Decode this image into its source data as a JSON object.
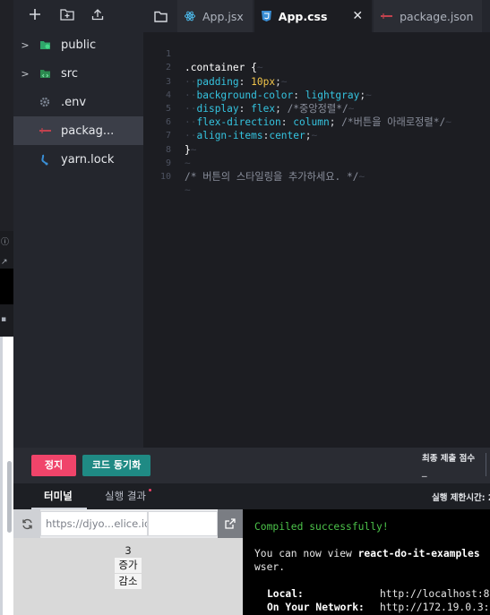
{
  "explorer": {
    "items": [
      {
        "name": "public",
        "type": "folder"
      },
      {
        "name": "src",
        "type": "folder"
      },
      {
        "name": ".env",
        "type": "file"
      },
      {
        "name": "packag...",
        "type": "file",
        "selected": true
      },
      {
        "name": "yarn.lock",
        "type": "file"
      }
    ]
  },
  "tabs": [
    {
      "label": "App.jsx",
      "icon": "react-icon"
    },
    {
      "label": "App.css",
      "icon": "css-icon",
      "active": true
    },
    {
      "label": "package.json",
      "icon": "json-icon"
    }
  ],
  "code": {
    "line_numbers": [
      "1",
      "2",
      "3",
      "4",
      "5",
      "6",
      "7",
      "8",
      "9",
      "10"
    ],
    "l1": ".container {",
    "l2_prop": "padding",
    "l2_val": "10px",
    "l3_prop": "background-color",
    "l3_val": "lightgray",
    "l4_prop": "display",
    "l4_val": "flex",
    "l4_cmt": "/*중앙정렬*/",
    "l5_prop": "flex-direction",
    "l5_val": "column",
    "l5_cmt": "/*버튼을 아래로정렬*/",
    "l6_prop": "align-items",
    "l6_val": "center",
    "l7": "}",
    "l9": "/* 버튼의 스타일링을 추가하세요. */"
  },
  "actionbar": {
    "stop_label": "정지",
    "sync_label": "코드 동기화",
    "score_label": "최종 제출 점수",
    "score_value": "_"
  },
  "panel": {
    "terminal_tab": "터미널",
    "run_tab": "실행 결과",
    "time_limit": "실행 제한시간: 2"
  },
  "preview": {
    "url": "https://djyo...elice.io/",
    "count": "3",
    "increase_label": "증가",
    "decrease_label": "감소"
  },
  "terminal": {
    "compiled": "Compiled successfully!",
    "view_prefix": "You can now view ",
    "view_app": "react-do-it-examples",
    "view_suffix": "wser.",
    "local_label": "Local:",
    "local_url": "http://localhost:8",
    "network_label": "On Your Network:",
    "network_url": "http://172.19.0.3:"
  },
  "colors": {
    "stop_button": "#f0446a",
    "sync_button": "#1f8a84",
    "compiled_text": "#4cc34a",
    "css_property": "#35c4e0",
    "css_number": "#f3c64a"
  }
}
